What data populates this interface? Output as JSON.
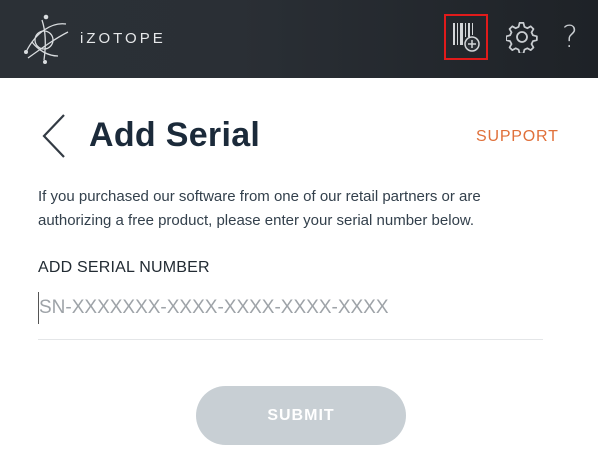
{
  "header": {
    "logo_text": "iZOTOPE",
    "help_glyph": "?",
    "icons": [
      "izotope-logo-icon",
      "barcode-add-icon",
      "gear-icon",
      "help-icon"
    ]
  },
  "page": {
    "title": "Add Serial",
    "support_label": "SUPPORT",
    "description": "If you purchased our software from one of our retail partners or are authorizing a free product, please enter your serial number below.",
    "field_label": "ADD SERIAL NUMBER",
    "serial_input": {
      "value": "",
      "placeholder": "SN-XXXXXXX-XXXX-XXXX-XXXX-XXXX"
    },
    "submit_label": "SUBMIT"
  },
  "colors": {
    "header_bg": "#2a2f35",
    "accent_orange": "#e0703a",
    "title_navy": "#1b2a3a",
    "submit_disabled": "#c8cfd4",
    "highlight_red": "#e01b1b"
  }
}
